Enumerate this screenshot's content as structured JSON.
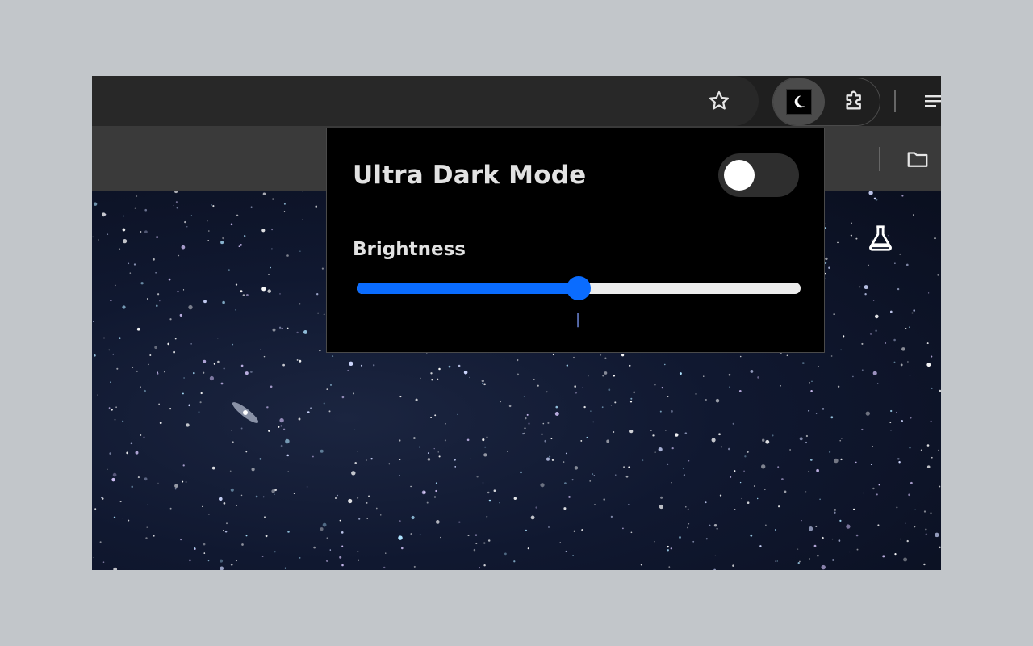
{
  "colors": {
    "page_background": "#c2c6ca",
    "toolbar": "#1f1f1f",
    "omnibox": "#282828",
    "bookmarks_bar": "#3a3a3a",
    "popup_background": "#000000",
    "accent": "#0a6cff",
    "track": "#ededed",
    "text": "#e2e2e2"
  },
  "toolbar": {
    "bookmark_icon": "star-outline-icon",
    "extension_icon": "moon-icon",
    "extensions_menu_icon": "puzzle-icon",
    "menu_icon": "reading-list-icon"
  },
  "bookmarks_bar": {
    "folder_icon": "folder-icon"
  },
  "page": {
    "labs_icon": "flask-icon"
  },
  "popup": {
    "title": "Ultra Dark Mode",
    "toggle": {
      "state": "off"
    },
    "brightness": {
      "label": "Brightness",
      "value_fraction": 0.5,
      "value_text": "|"
    }
  }
}
